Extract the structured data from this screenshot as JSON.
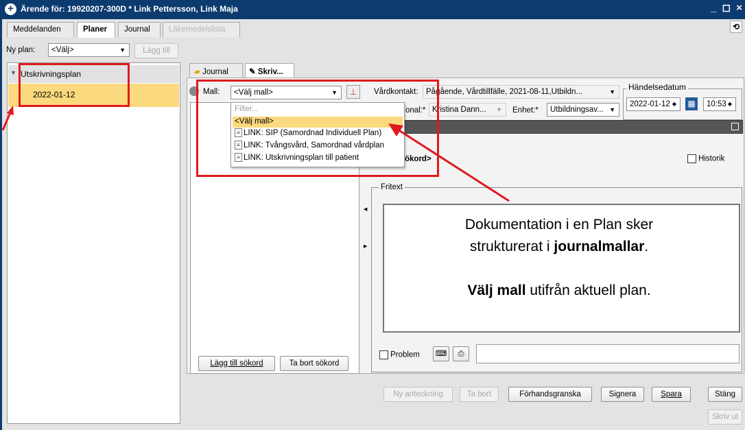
{
  "window": {
    "title": "Ärende för: 19920207-300D * Link Pettersson, Link Maja",
    "controls": "_ ◻ ×"
  },
  "tabs": [
    "Meddelanden",
    "Planer",
    "Journal",
    "Läkemedelslista"
  ],
  "ny_plan": {
    "label": "Ny plan:",
    "value": "<Välj>",
    "add_button": "Lägg till"
  },
  "tree": {
    "group": "Utskrivningsplan",
    "item": "2022-01-12"
  },
  "subtabs": {
    "journal": "Journal",
    "skriv": "Skriv..."
  },
  "mall": {
    "label": "Mall:",
    "value": "<Välj mall>"
  },
  "dropdown": {
    "filter_placeholder": "Filter...",
    "items": [
      "<Välj mall>",
      "LINK: SIP (Samordnad Individuell Plan)",
      "LINK: Tvångsvård, Samordnad vårdplan",
      "LINK: Utskrivningsplan till patient"
    ]
  },
  "vardkontakt": {
    "label": "Vårdkontakt:",
    "value": "Pågående, Vårdtillfälle, 2021-08-11,Utbildn..."
  },
  "personal": {
    "label": "onal:*",
    "value": "Kristina Dann..."
  },
  "enhet": {
    "label": "Enhet:*",
    "value": "Utbildningsav..."
  },
  "handelsedatum": {
    "legend": "Händelsedatum",
    "date": "2022-01-12",
    "time": "10:53"
  },
  "sokord_fragment": "ökord>",
  "historik": "Historik",
  "fritext_legend": "Fritext",
  "annotation": {
    "line1": "Dokumentation i en Plan sker",
    "line2_pre": "strukturerat i ",
    "line2_bold": "journalmallar",
    "line2_post": ".",
    "line3_bold": "Välj mall",
    "line3_post": " utifrån aktuell plan."
  },
  "problem": "Problem",
  "sokord_buttons": {
    "add": "Lägg till sökord",
    "remove": "Ta bort sökord"
  },
  "bottom": {
    "ny": "Ny anteckning",
    "ta_bort": "Ta bort",
    "forhand": "Förhandsgranska",
    "signera": "Signera",
    "spara": "Spara",
    "stang": "Stäng",
    "skriv_ut": "Skriv ut"
  },
  "colors": {
    "title_bar": "#0c3b6f",
    "highlight": "#fbd97e",
    "annotation_red": "#e0191f"
  }
}
